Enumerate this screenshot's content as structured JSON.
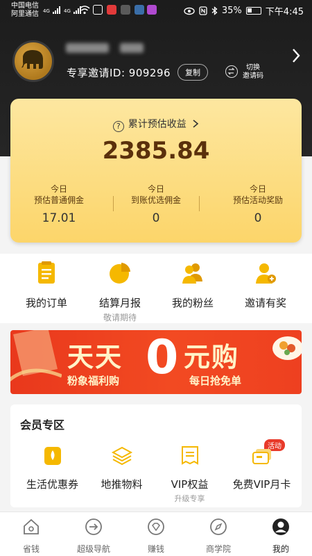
{
  "status_bar": {
    "carrier1": "中国电信",
    "carrier2": "阿里通信",
    "net1": "4G",
    "net2": "4G",
    "battery": "35%",
    "time": "下午4:45"
  },
  "profile": {
    "invite_label": "专享邀请ID: 909296",
    "copy_label": "复制",
    "switch_label_line1": "切换",
    "switch_label_line2": "邀请码"
  },
  "earnings": {
    "title": "累计预估收益",
    "total": "2385.84",
    "columns": [
      {
        "line1": "今日",
        "line2": "预估普通佣金",
        "value": "17.01"
      },
      {
        "line1": "今日",
        "line2": "到账优选佣金",
        "value": "0"
      },
      {
        "line1": "今日",
        "line2": "预估活动奖励",
        "value": "0"
      }
    ]
  },
  "features": [
    {
      "label": "我的订单",
      "sub": ""
    },
    {
      "label": "结算月报",
      "sub": "敬请期待"
    },
    {
      "label": "我的粉丝",
      "sub": ""
    },
    {
      "label": "邀请有奖",
      "sub": ""
    }
  ],
  "banner": {
    "left": "天天",
    "zero": "0",
    "right": "元购",
    "sub_left": "粉象福利购",
    "sub_right": "每日抢免单"
  },
  "member": {
    "title": "会员专区",
    "badge": "活动",
    "items": [
      {
        "label": "生活优惠券",
        "sub": ""
      },
      {
        "label": "地推物料",
        "sub": ""
      },
      {
        "label": "VIP权益",
        "sub": "升级专享"
      },
      {
        "label": "免费VIP月卡",
        "sub": ""
      }
    ]
  },
  "nav": [
    {
      "label": "省钱"
    },
    {
      "label": "超级导航"
    },
    {
      "label": "赚钱"
    },
    {
      "label": "商学院"
    },
    {
      "label": "我的"
    }
  ],
  "colors": {
    "accent": "#f5b800",
    "header_bg": "#1c1c1c",
    "card_bg": "#fcd56a",
    "banner_bg": "#f24a22"
  }
}
